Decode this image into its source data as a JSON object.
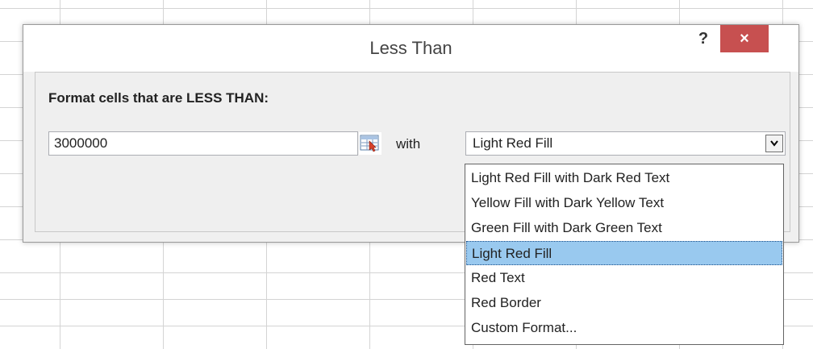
{
  "dialog": {
    "title": "Less Than",
    "help_label": "?",
    "close_label": "×",
    "prompt": "Format cells that are LESS THAN:",
    "value": "3000000",
    "with_label": "with",
    "format_selected": "Light Red Fill",
    "chevron": "▾"
  },
  "dropdown": {
    "options": [
      "Light Red Fill with Dark Red Text",
      "Yellow Fill with Dark Yellow Text",
      "Green Fill with Dark Green Text",
      "Light Red Fill",
      "Red Text",
      "Red Border",
      "Custom Format..."
    ],
    "selected_index": 3
  },
  "colors": {
    "close_button": "#c75050",
    "selection": "#99c9ef",
    "dialog_bg": "#f0f0f0"
  }
}
